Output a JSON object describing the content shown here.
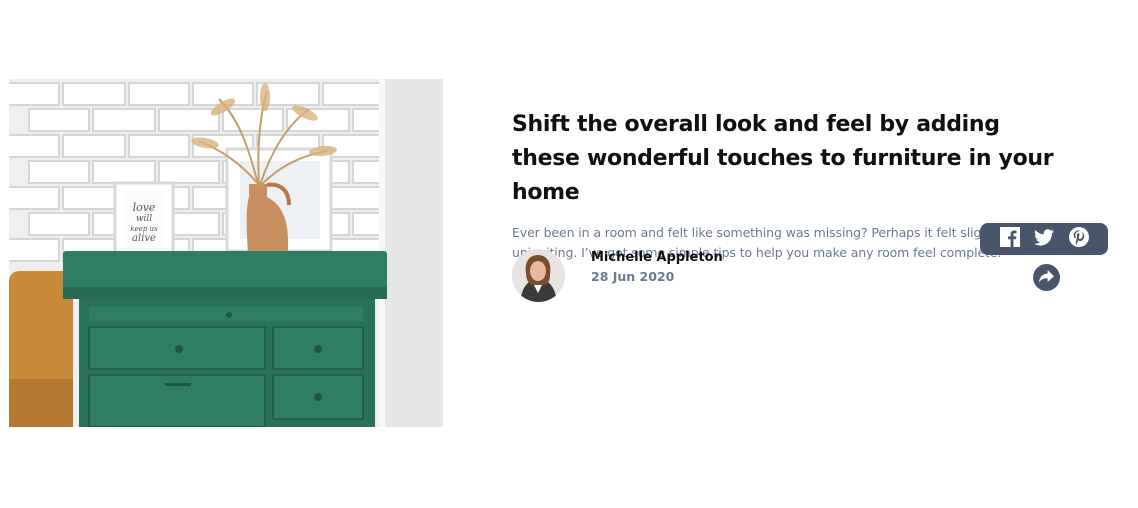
{
  "article": {
    "title": "Shift the overall look and feel by adding these wonderful touches to furniture in your home",
    "description": "Ever been in a room and felt like something was missing? Perhaps it felt slightly bare and uninviting. I’ve got some simple tips to help you make any room feel complete."
  },
  "author": {
    "name": "Michelle Appleton",
    "date": "28 Jun 2020"
  },
  "hero": {
    "frame_text_lines": [
      "love",
      "will",
      "keep us",
      "alive"
    ]
  },
  "share": {
    "icons": [
      "facebook-icon",
      "twitter-icon",
      "pinterest-icon",
      "share-arrow-icon"
    ]
  },
  "colors": {
    "title": "#0f1011",
    "text_muted": "#6b7a93",
    "share_bg": "#48556a",
    "cabinet_green": "#2f7d63"
  }
}
